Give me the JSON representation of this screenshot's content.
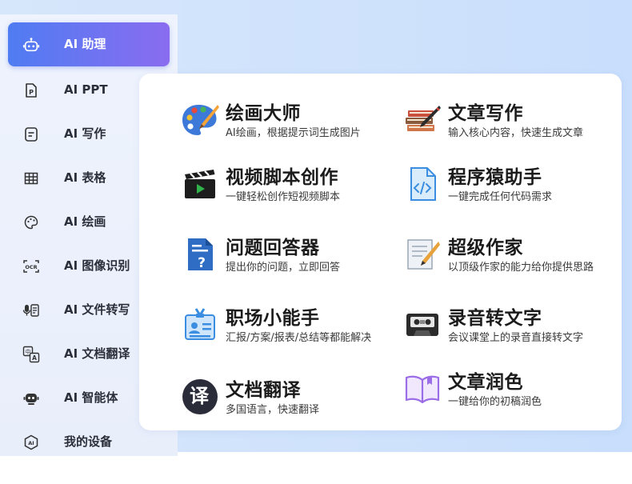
{
  "sidebar": {
    "items": [
      {
        "label": "AI 助理",
        "icon": "robot-icon",
        "active": true
      },
      {
        "label": "AI PPT",
        "icon": "ppt-file-icon",
        "active": false
      },
      {
        "label": "AI 写作",
        "icon": "document-icon",
        "active": false
      },
      {
        "label": "AI 表格",
        "icon": "table-icon",
        "active": false
      },
      {
        "label": "AI 绘画",
        "icon": "palette-icon",
        "active": false
      },
      {
        "label": "AI 图像识别",
        "icon": "ocr-scan-icon",
        "active": false
      },
      {
        "label": "AI 文件转写",
        "icon": "voice-transcribe-icon",
        "active": false
      },
      {
        "label": "AI 文档翻译",
        "icon": "translate-icon",
        "active": false
      },
      {
        "label": "AI 智能体",
        "icon": "agent-icon",
        "active": false
      },
      {
        "label": "我的设备",
        "icon": "device-icon",
        "active": false
      }
    ],
    "accent_from": "#4f7cf2",
    "accent_to": "#8a6cf0"
  },
  "tools": [
    {
      "title": "绘画大师",
      "desc": "AI绘画，根据提示词生成图片",
      "icon": "palette-brush-icon"
    },
    {
      "title": "文章写作",
      "desc": "输入核心内容，快速生成文章",
      "icon": "books-pen-icon"
    },
    {
      "title": "视频脚本创作",
      "desc": "一键轻松创作短视频脚本",
      "icon": "clapperboard-icon"
    },
    {
      "title": "程序猿助手",
      "desc": "一键完成任何代码需求",
      "icon": "code-file-icon"
    },
    {
      "title": "问题回答器",
      "desc": "提出你的问题，立即回答",
      "icon": "question-doc-icon"
    },
    {
      "title": "超级作家",
      "desc": "以顶级作家的能力给你提供思路",
      "icon": "paper-quill-icon"
    },
    {
      "title": "职场小能手",
      "desc": "汇报/方案/报表/总结等都能解决",
      "icon": "id-badge-icon"
    },
    {
      "title": "录音转文字",
      "desc": "会议课堂上的录音直接转文字",
      "icon": "cassette-icon"
    },
    {
      "title": "文档翻译",
      "desc": "多国语言，快速翻译",
      "icon": "translate-circle-icon",
      "icon_text": "译"
    },
    {
      "title": "文章润色",
      "desc": "一键给你的初稿润色",
      "icon": "open-book-icon"
    }
  ]
}
